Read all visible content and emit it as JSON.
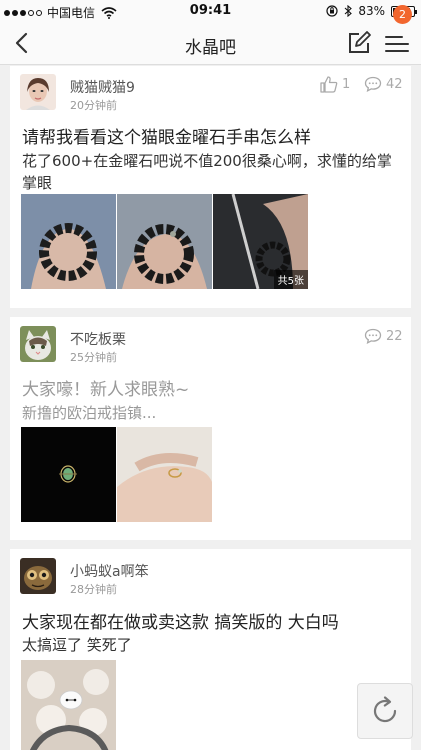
{
  "status_bar": {
    "carrier": "中国电信",
    "time": "09:41",
    "battery": "83%",
    "battery_level": 0.83
  },
  "nav": {
    "title": "水晶吧",
    "badge": "2"
  },
  "posts": [
    {
      "username": "贼猫贼猫9",
      "time": "20分钟前",
      "likes": "1",
      "comments": "42",
      "title": "请帮我看看这个猫眼金曜石手串怎么样",
      "excerpt": "花了600+在金曜石吧说不值200很桑心啊，求懂的给掌掌眼",
      "image_count": "共5张"
    },
    {
      "username": "不吃板栗",
      "time": "25分钟前",
      "comments": "22",
      "title": "大家嚎！新人求眼熟~",
      "excerpt": "新撸的欧泊戒指镇..."
    },
    {
      "username": "小蚂蚁a啊笨",
      "time": "28分钟前",
      "title": "大家现在都在做或卖这款 搞笑版的 大白吗",
      "excerpt": "太搞逗了 笑死了"
    }
  ]
}
